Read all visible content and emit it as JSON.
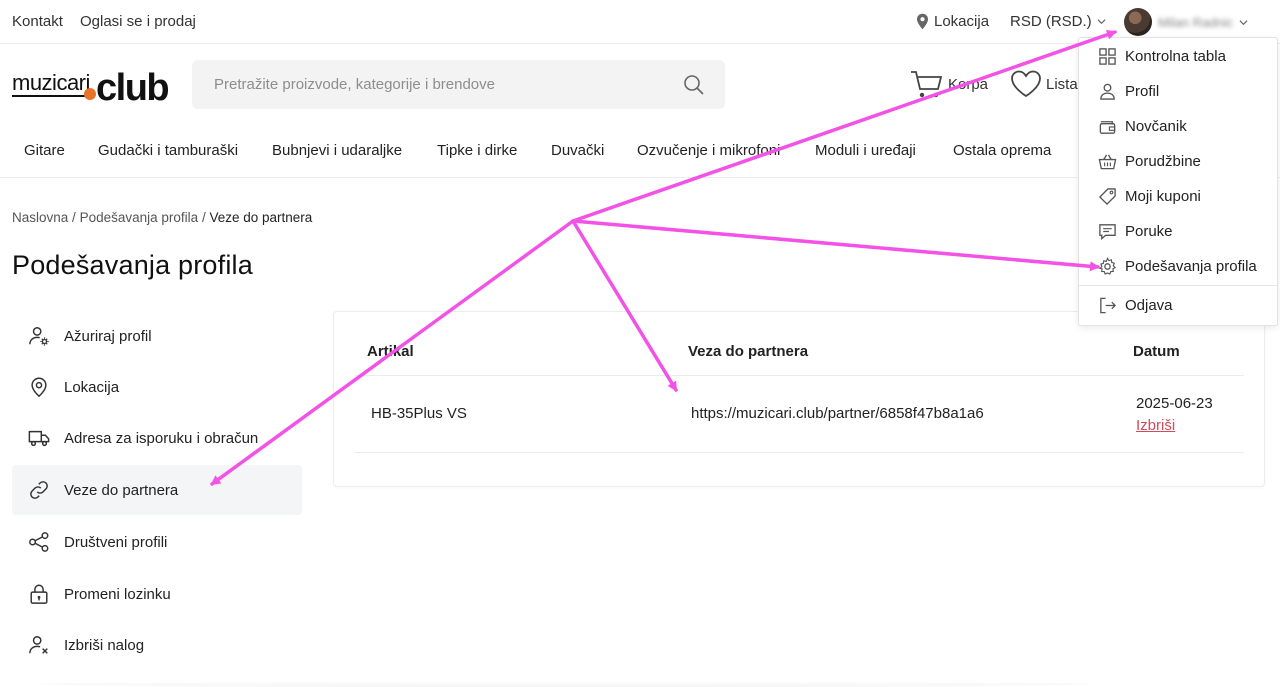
{
  "topbar": {
    "contact": "Kontakt",
    "ads": "Oglasi se i prodaj",
    "location": "Lokacija",
    "currency": "RSD (RSD.)",
    "user_name": "Milan Radnic"
  },
  "header": {
    "logo_text_left": "muzicari",
    "logo_text_right": "club",
    "search_placeholder": "Pretražite proizvode, kategorije i brendove",
    "cart": "Korpa",
    "wishlist": "Lista"
  },
  "nav": [
    "Gitare",
    "Gudački i tamburaški",
    "Bubnjevi i udaraljke",
    "Tipke i dirke",
    "Duvački",
    "Ozvučenje i mikrofoni",
    "Moduli i uređaji",
    "Ostala oprema"
  ],
  "breadcrumb": {
    "home": "Naslovna",
    "sep": "/",
    "settings": "Podešavanja profila",
    "current": "Veze do partnera"
  },
  "page_title": "Podešavanja profila",
  "sidebar": [
    {
      "label": "Ažuriraj profil",
      "icon": "user-gear-icon"
    },
    {
      "label": "Lokacija",
      "icon": "location-pin-icon"
    },
    {
      "label": "Adresa za isporuku i obračun",
      "icon": "truck-icon"
    },
    {
      "label": "Veze do partnera",
      "icon": "link-icon",
      "active": true
    },
    {
      "label": "Društveni profili",
      "icon": "share-icon"
    },
    {
      "label": "Promeni lozinku",
      "icon": "lock-icon"
    },
    {
      "label": "Izbriši nalog",
      "icon": "user-x-icon"
    }
  ],
  "table": {
    "headers": [
      "Artikal",
      "Veza do partnera",
      "Datum"
    ],
    "rows": [
      {
        "article": "HB-35Plus VS",
        "link": "https://muzicari.club/partner/6858f47b8a1a6",
        "date": "2025-06-23",
        "delete": "Izbriši"
      }
    ]
  },
  "dropdown": [
    {
      "label": "Kontrolna tabla",
      "icon": "grid-icon"
    },
    {
      "label": "Profil",
      "icon": "user-icon"
    },
    {
      "label": "Novčanik",
      "icon": "wallet-icon"
    },
    {
      "label": "Porudžbine",
      "icon": "basket-icon"
    },
    {
      "label": "Moji kuponi",
      "icon": "tag-icon"
    },
    {
      "label": "Poruke",
      "icon": "message-icon"
    },
    {
      "label": "Podešavanja profila",
      "icon": "gear-icon"
    },
    {
      "label": "Odjava",
      "icon": "logout-icon"
    }
  ],
  "colors": {
    "accent_orange": "#e8732a",
    "annotation_magenta": "#f252e6",
    "delete_red": "#d24b5a"
  }
}
